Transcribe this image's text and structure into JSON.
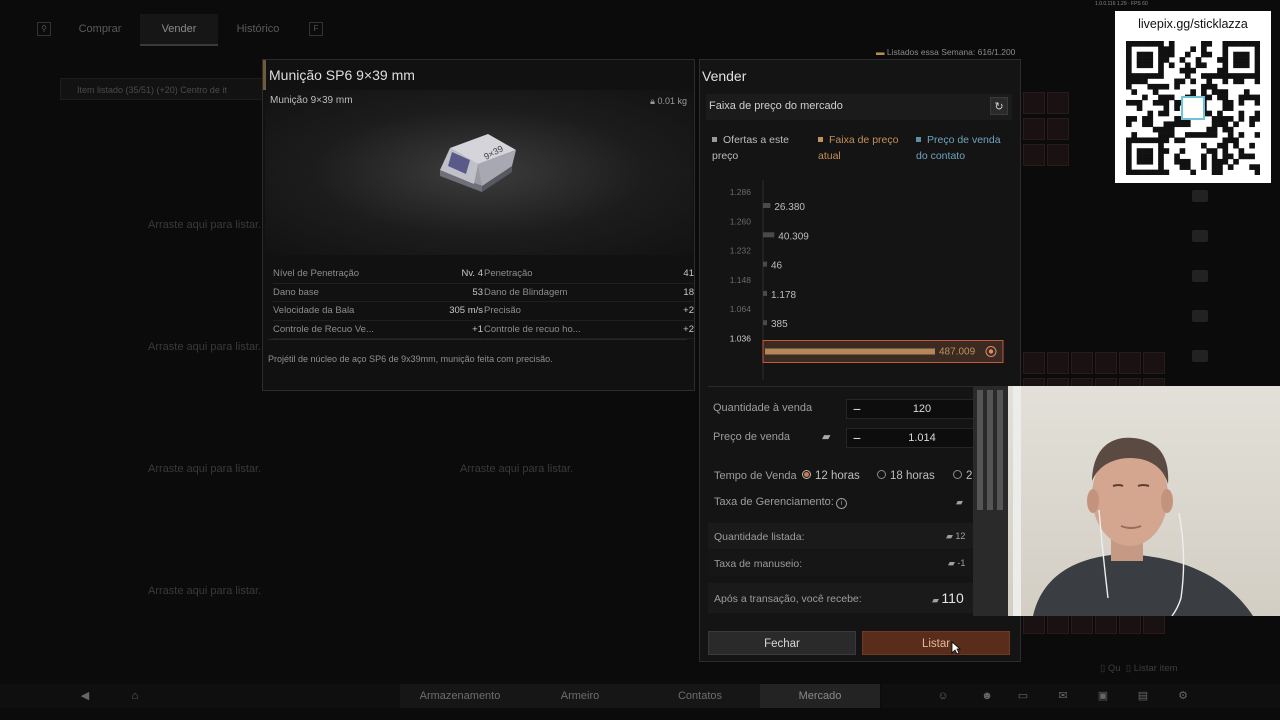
{
  "debug_text": "1.0.0.116 1.29 · FPS 60",
  "top_tabs": {
    "icon_left": "magnifier-icon",
    "comprar": "Comprar",
    "vender": "Vender",
    "historico": "Histórico",
    "icon_right": "F"
  },
  "filter_text": "Item listado (35/51)  (+20)  Centro de it",
  "weekly": "Listados essa Semana: 616/1.200",
  "drop_hint": "Arraste aqui para listar.",
  "item": {
    "title": "Munição SP6 9×39 mm",
    "short_name": "Munição 9×39 mm",
    "weight": "0.01 kg",
    "stats_left": [
      {
        "label": "Nível de Penetração",
        "value": "Nv. 4"
      },
      {
        "label": "Dano base",
        "value": "53"
      },
      {
        "label": "Velocidade da Bala",
        "value": "305 m/s"
      },
      {
        "label": "Controle de Recuo Ve...",
        "value": "+1"
      }
    ],
    "stats_right": [
      {
        "label": "Penetração",
        "value": "41"
      },
      {
        "label": "Dano de Blindagem",
        "value": "18"
      },
      {
        "label": "Precisão",
        "value": "+2"
      },
      {
        "label": "Controle de recuo ho...",
        "value": "+2"
      }
    ],
    "description": "Projétil de núcleo de aço SP6 de 9x39mm, munição feita com precisão."
  },
  "sell": {
    "title": "Vender",
    "range_label": "Faixa de preço do mercado",
    "legend": [
      {
        "label": "Ofertas a este preço",
        "color": "#9a9a9a"
      },
      {
        "label": "Faixa de preço atual",
        "color": "#c2905a"
      },
      {
        "label": "Preço de venda do contato",
        "color": "#5b8fa8"
      }
    ],
    "quantity_label": "Quantidade à venda",
    "quantity_value": "120",
    "price_label": "Preço de venda",
    "price_value": "1.014",
    "time_label": "Tempo de Venda",
    "time_options": [
      "12 horas",
      "18 horas",
      "2"
    ],
    "fee_label": "Taxa de Gerenciamento:",
    "listed_qty_label": "Quantidade listada:",
    "listed_qty_value": "12",
    "handling_label": "Taxa de manuseio:",
    "handling_value": "-1",
    "receive_label": "Após a transação, você recebe:",
    "receive_value": "110",
    "close_label": "Fechar",
    "list_label": "Listar"
  },
  "chart_data": {
    "type": "bar",
    "orientation": "horizontal",
    "categories": [
      "1.286",
      "1.260",
      "1.232",
      "1.148",
      "1.064",
      "1.036"
    ],
    "values": [
      26380,
      40309,
      46,
      1178,
      385,
      487009
    ],
    "labels": [
      "26.380",
      "40.309",
      "46",
      "1.178",
      "385",
      "487.009"
    ],
    "highlight_index": 5,
    "colors": {
      "normal": "#4a4a4a",
      "highlight": "#b3875a"
    }
  },
  "qr_text": "livepix.gg/sticklazza",
  "list_hint": "Listar item",
  "list_hint_prefix": "Qu",
  "bottom_tabs": [
    "Armazenamento",
    "Armeiro",
    "Contatos",
    "Mercado"
  ]
}
